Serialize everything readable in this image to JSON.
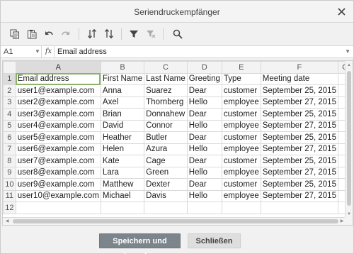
{
  "window": {
    "title": "Seriendruckempfänger",
    "close_icon": "close-icon"
  },
  "toolbar": {
    "buttons": [
      {
        "name": "copy-icon"
      },
      {
        "name": "paste-icon"
      },
      {
        "name": "undo-icon"
      },
      {
        "name": "redo-icon"
      },
      {
        "name": "sort-ascending-icon"
      },
      {
        "name": "sort-descending-icon"
      },
      {
        "name": "filter-icon"
      },
      {
        "name": "clear-filter-icon"
      },
      {
        "name": "search-icon"
      }
    ]
  },
  "formula_bar": {
    "cell_ref": "A1",
    "fx_label": "fx",
    "value": "Email address"
  },
  "sheet": {
    "columns": [
      "A",
      "B",
      "C",
      "D",
      "E",
      "F",
      "G"
    ],
    "rows": [
      [
        "Email address",
        "First Name",
        "Last Name",
        "Greeting",
        "Type",
        "Meeting date",
        ""
      ],
      [
        "user1@example.com",
        "Anna",
        "Suarez",
        "Dear",
        "customer",
        "September 25, 2015",
        ""
      ],
      [
        "user2@example.com",
        "Axel",
        "Thornberg",
        "Hello",
        "employee",
        "September 27, 2015",
        ""
      ],
      [
        "user3@example.com",
        "Brian",
        "Donnahew",
        "Dear",
        "customer",
        "September 25, 2015",
        ""
      ],
      [
        "user4@example.com",
        "David",
        "Connor",
        "Hello",
        "employee",
        "September 27, 2015",
        ""
      ],
      [
        "user5@example.com",
        "Heather",
        "Butler",
        "Dear",
        "customer",
        "September 25, 2015",
        ""
      ],
      [
        "user6@example.com",
        "Helen",
        "Azura",
        "Hello",
        "employee",
        "September 27, 2015",
        ""
      ],
      [
        "user7@example.com",
        "Kate",
        "Cage",
        "Dear",
        "customer",
        "September 25, 2015",
        ""
      ],
      [
        "user8@example.com",
        "Lara",
        "Green",
        "Hello",
        "employee",
        "September 27, 2015",
        ""
      ],
      [
        "user9@example.com",
        "Matthew",
        "Dexter",
        "Dear",
        "customer",
        "September 25, 2015",
        ""
      ],
      [
        "user10@example.com",
        "Michael",
        "Davis",
        "Hello",
        "employee",
        "September 27, 2015",
        ""
      ],
      [
        "",
        "",
        "",
        "",
        "",
        "",
        ""
      ]
    ],
    "active_cell": "A1"
  },
  "footer": {
    "save_label": "Speichern und beenden",
    "close_label": "Schließen"
  },
  "colors": {
    "active_cell_border": "#8db36b",
    "primary_button": "#7d858c",
    "selected_header": "#dcdcdc"
  }
}
